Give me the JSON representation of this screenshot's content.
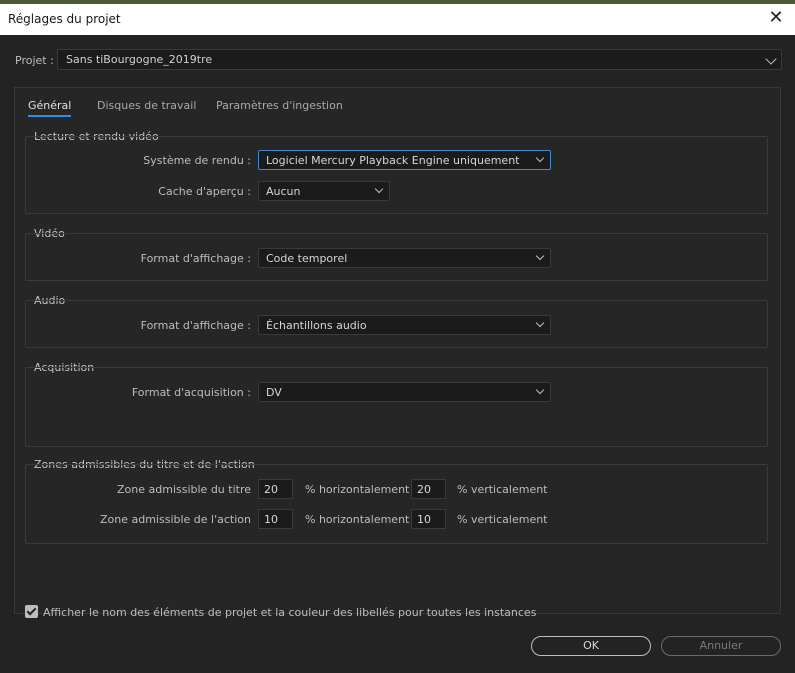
{
  "window": {
    "title": "Réglages du projet",
    "close_glyph": "✕"
  },
  "project": {
    "label": "Projet :",
    "value": "Sans tiBourgogne_2019tre"
  },
  "tabs": [
    {
      "label": "Général",
      "active": true
    },
    {
      "label": "Disques de travail",
      "active": false
    },
    {
      "label": "Paramètres d'ingestion",
      "active": false
    }
  ],
  "playback": {
    "title": "Lecture et rendu vidéo",
    "renderer_label": "Système de rendu :",
    "renderer_value": "Logiciel Mercury Playback Engine uniquement",
    "preview_cache_label": "Cache d'aperçu :",
    "preview_cache_value": "Aucun"
  },
  "video": {
    "title": "Vidéo",
    "display_format_label": "Format d'affichage :",
    "display_format_value": "Code temporel"
  },
  "audio": {
    "title": "Audio",
    "display_format_label": "Format d'affichage :",
    "display_format_value": "Échantillons audio"
  },
  "capture": {
    "title": "Acquisition",
    "format_label": "Format d'acquisition :",
    "format_value": "DV"
  },
  "safe_margins": {
    "title": "Zones admissibles du titre et de l'action",
    "title_safe_label": "Zone admissible du titre",
    "title_safe_h": "20",
    "title_safe_v": "20",
    "action_safe_label": "Zone admissible de l'action",
    "action_safe_h": "10",
    "action_safe_v": "10",
    "h_unit": "% horizontalement",
    "v_unit": "% verticalement"
  },
  "show_names_checkbox": {
    "checked": true,
    "label": "Afficher le nom des éléments de projet et la couleur des libellés pour toutes les instances"
  },
  "buttons": {
    "ok": "OK",
    "cancel": "Annuler"
  },
  "colors": {
    "accent": "#2d8ceb",
    "background": "#232323",
    "panel": "#262626",
    "field": "#1b1b1b"
  }
}
